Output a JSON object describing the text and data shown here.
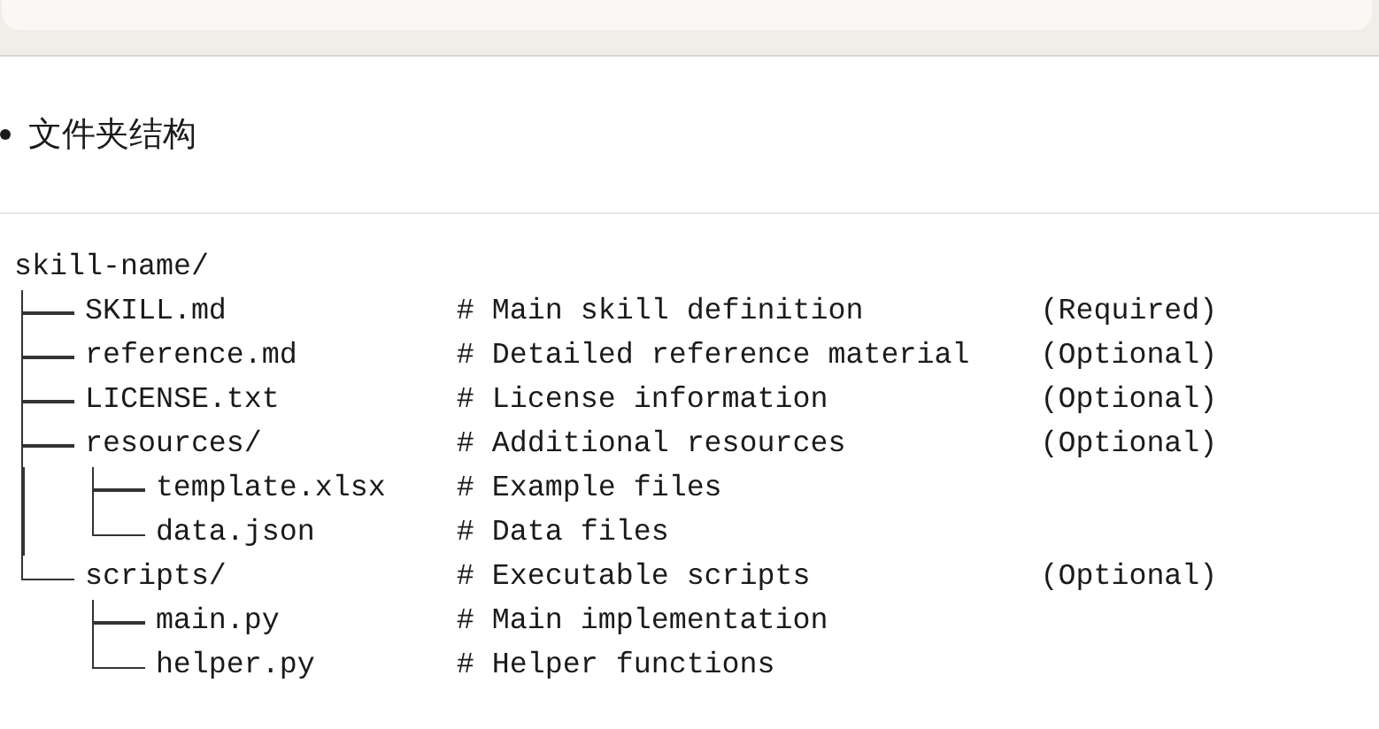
{
  "heading": "文件夹结构",
  "tree": {
    "name": "skill-name/",
    "children": [
      {
        "name": "SKILL.md",
        "comment": "# Main skill definition",
        "note": "(Required)"
      },
      {
        "name": "reference.md",
        "comment": "# Detailed reference material",
        "note": "(Optional)"
      },
      {
        "name": "LICENSE.txt",
        "comment": "# License information",
        "note": "(Optional)"
      },
      {
        "name": "resources/",
        "comment": "# Additional resources",
        "note": "(Optional)",
        "children": [
          {
            "name": "template.xlsx",
            "comment": "# Example files"
          },
          {
            "name": "data.json",
            "comment": "# Data files"
          }
        ]
      },
      {
        "name": "scripts/",
        "comment": "# Executable scripts",
        "note": "(Optional)",
        "children": [
          {
            "name": "main.py",
            "comment": "# Main implementation"
          },
          {
            "name": "helper.py",
            "comment": "# Helper functions"
          }
        ]
      }
    ]
  }
}
